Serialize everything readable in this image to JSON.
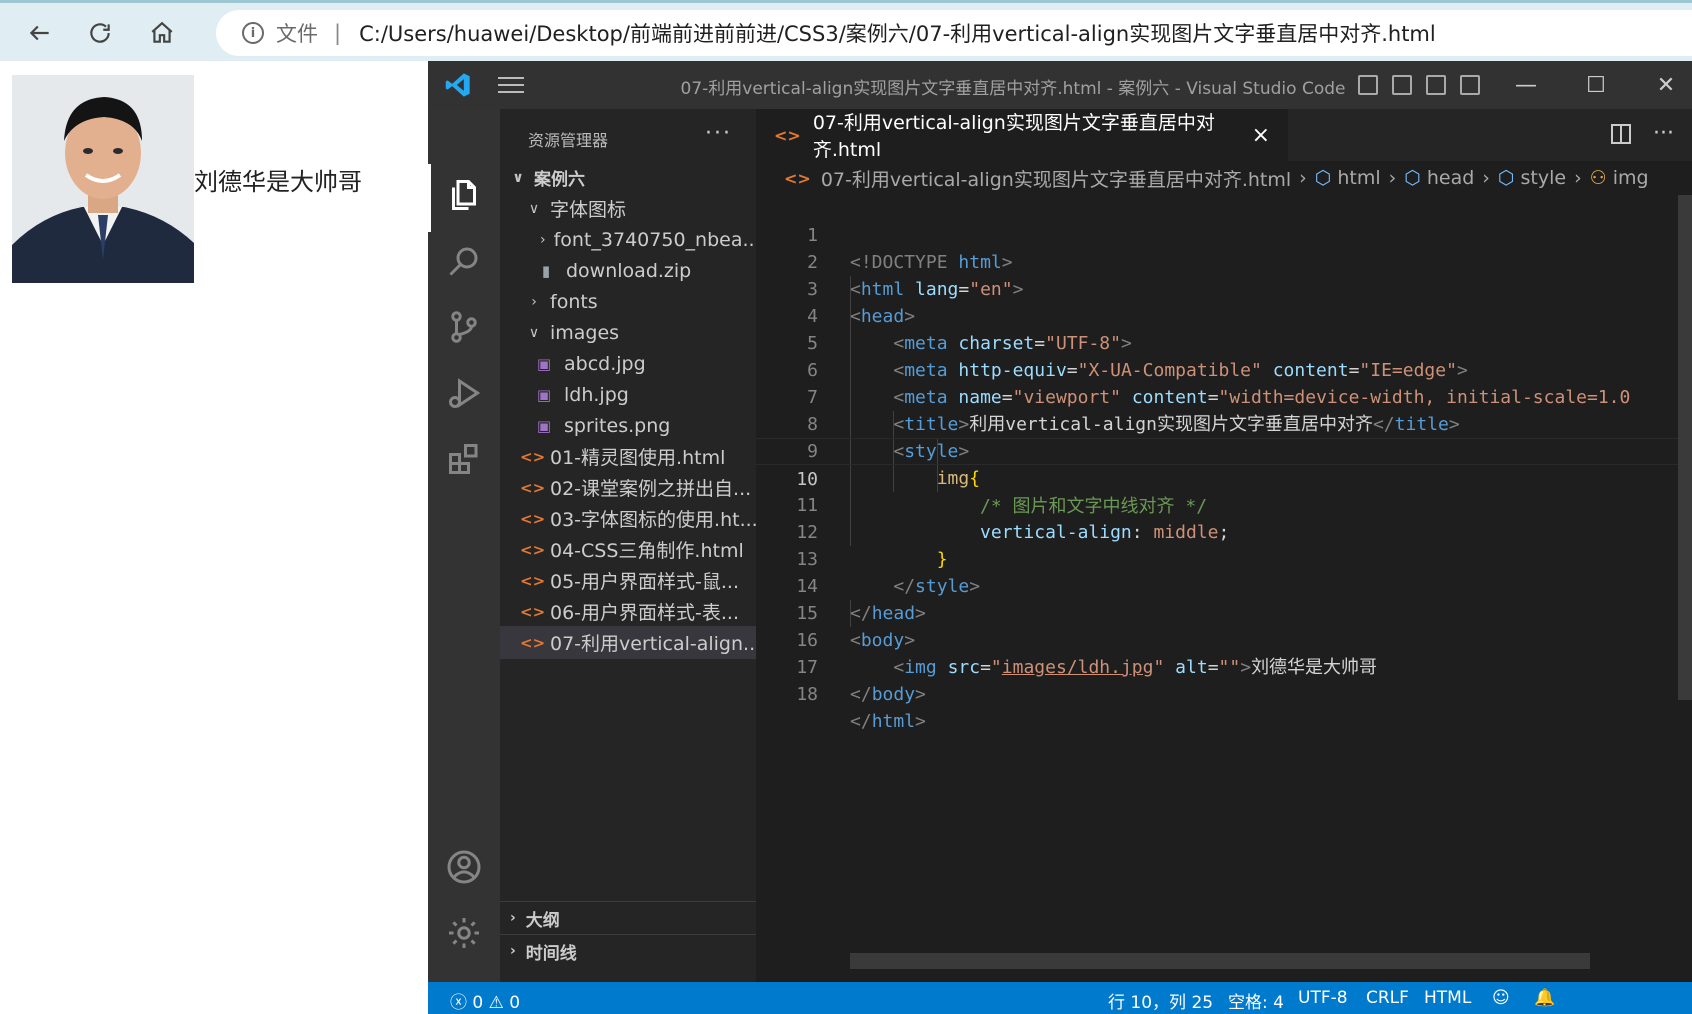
{
  "browser": {
    "file_label": "文件",
    "separator": "|",
    "address": "C:/Users/huawei/Desktop/前端前进前前进/CSS3/案例六/07-利用vertical-align实现图片文字垂直居中对齐.html"
  },
  "page": {
    "caption": "刘德华是大帅哥"
  },
  "vscode": {
    "window_title": "07-利用vertical-align实现图片文字垂直居中对齐.html - 案例六 - Visual Studio Code",
    "explorer_title": "资源管理器",
    "more": "···",
    "tree": [
      {
        "label": "案例六",
        "chev": "∨",
        "type": "folder-root"
      },
      {
        "label": "字体图标",
        "chev": "∨",
        "type": "folder"
      },
      {
        "label": "font_3740750_nbea...",
        "chev": "›",
        "type": "folder"
      },
      {
        "label": "download.zip",
        "chev": "",
        "type": "zip"
      },
      {
        "label": "fonts",
        "chev": "›",
        "type": "folder"
      },
      {
        "label": "images",
        "chev": "∨",
        "type": "folder"
      },
      {
        "label": "abcd.jpg",
        "chev": "",
        "type": "img"
      },
      {
        "label": "ldh.jpg",
        "chev": "",
        "type": "img"
      },
      {
        "label": "sprites.png",
        "chev": "",
        "type": "img"
      },
      {
        "label": "01-精灵图使用.html",
        "chev": "",
        "type": "html"
      },
      {
        "label": "02-课堂案例之拼出自...",
        "chev": "",
        "type": "html"
      },
      {
        "label": "03-字体图标的使用.ht...",
        "chev": "",
        "type": "html"
      },
      {
        "label": "04-CSS三角制作.html",
        "chev": "",
        "type": "html"
      },
      {
        "label": "05-用户界面样式-鼠...",
        "chev": "",
        "type": "html"
      },
      {
        "label": "06-用户界面样式-表...",
        "chev": "",
        "type": "html"
      },
      {
        "label": "07-利用vertical-align...",
        "chev": "",
        "type": "html"
      }
    ],
    "outline_label": "大纲",
    "timeline_label": "时间线",
    "tab_label": "07-利用vertical-align实现图片文字垂直居中对齐.html",
    "tab_close": "×",
    "breadcrumb": {
      "file": "07-利用vertical-align实现图片文字垂直居中对齐.html",
      "html": "html",
      "head": "head",
      "style": "style",
      "img": "img"
    },
    "code": {
      "l1_doctype": "<!DOCTYPE",
      "l1_html": "html",
      "l2_tag": "html",
      "l2_attr": "lang",
      "l2_val": "\"en\"",
      "l3_tag": "head",
      "l4_tag": "meta",
      "l4_attr": "charset",
      "l4_val": "\"UTF-8\"",
      "l5_tag": "meta",
      "l5_attr1": "http-equiv",
      "l5_val1": "\"X-UA-Compatible\"",
      "l5_attr2": "content",
      "l5_val2": "\"IE=edge\"",
      "l6_tag": "meta",
      "l6_attr1": "name",
      "l6_val1": "\"viewport\"",
      "l6_attr2": "content",
      "l6_val2": "\"width=device-width, initial-scale=1.0",
      "l7_tag": "title",
      "l7_text": "利用vertical-align实现图片文字垂直居中对齐",
      "l8_tag": "style",
      "l9_sel": "img",
      "l10_cmt": "/* 图片和文字中线对齐 */",
      "l11_prop": "vertical-align",
      "l11_val": "middle",
      "l13_tag": "style",
      "l14_tag": "head",
      "l15_tag": "body",
      "l16_tag": "img",
      "l16_attr1": "src",
      "l16_val1": "images/ldh.jpg",
      "l16_attr2": "alt",
      "l16_val2": "\"\"",
      "l16_text": "刘德华是大帅哥",
      "l17_tag": "body",
      "l18_tag": "html"
    },
    "line_numbers": [
      "1",
      "2",
      "3",
      "4",
      "5",
      "6",
      "7",
      "8",
      "9",
      "10",
      "11",
      "12",
      "13",
      "14",
      "15",
      "16",
      "17",
      "18"
    ],
    "status": {
      "errors": "0",
      "warnings": "0",
      "position": "行 10，列 25",
      "spaces": "空格: 4",
      "encoding": "UTF-8",
      "eol": "CRLF",
      "language": "HTML"
    },
    "colors": {
      "accent": "#007acc",
      "editor_bg": "#1e1e1e",
      "sidebar_bg": "#252526"
    }
  }
}
